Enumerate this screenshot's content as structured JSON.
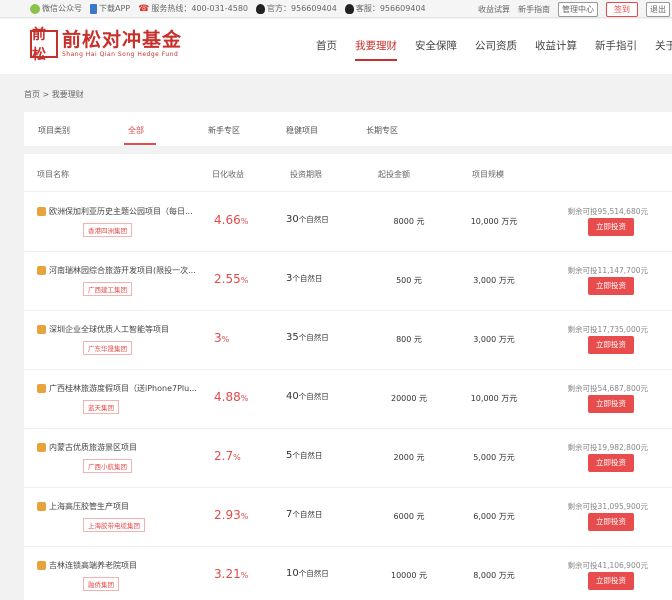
{
  "topbar": {
    "wechat": "微信公众号",
    "app": "下载APP",
    "hotline": "服务热线：400-031-4580",
    "official": "官方：956609404",
    "service": "客服：956609404",
    "links": [
      "收益试算",
      "新手指南"
    ],
    "manage": "管理中心",
    "sign": "签到",
    "logout": "退出"
  },
  "logo": {
    "mark": "前松",
    "cn": "前松对冲基金",
    "en": "Shang Hai Qian Song Hedge Fund"
  },
  "nav": [
    "首页",
    "我要理财",
    "安全保障",
    "公司资质",
    "收益计算",
    "新手指引",
    "关于我们"
  ],
  "breadcrumb": "首页 > 我要理财",
  "categories": {
    "label": "项目类别",
    "items": [
      "全部",
      "新手专区",
      "稳健项目",
      "长期专区"
    ]
  },
  "table": {
    "headers": [
      "项目名称",
      "日化收益",
      "投资期限",
      "起投金额",
      "项目规模"
    ],
    "unit_day": "个自然日",
    "remain_prefix": "剩余可投",
    "invest_label": "立即投资",
    "rows": [
      {
        "name": "欧洲保加利亚历史主题公园项目（每日...",
        "tag": "香港四洲集团",
        "rate": "4.66",
        "term": "30",
        "min": "8000 元",
        "scale": "10,000 万元",
        "remain": "95,514,680元"
      },
      {
        "name": "河南瑞林园综合旅游开发项目(限投一次...",
        "tag": "广西建工集团",
        "rate": "2.55",
        "term": "3",
        "min": "500 元",
        "scale": "3,000 万元",
        "remain": "11,147,700元"
      },
      {
        "name": "深圳企业全球优质人工智能等项目",
        "tag": "广东华晟集团",
        "rate": "3",
        "term": "35",
        "min": "800 元",
        "scale": "3,000 万元",
        "remain": "17,735,000元"
      },
      {
        "name": "广西桂林旅游度假项目（送iPhone7Plu...",
        "tag": "蓝天集团",
        "rate": "4.88",
        "term": "40",
        "min": "20000 元",
        "scale": "10,000 万元",
        "remain": "54,687,800元"
      },
      {
        "name": "内蒙古优质旅游景区项目",
        "tag": "广西小航集团",
        "rate": "2.7",
        "term": "5",
        "min": "2000 元",
        "scale": "5,000 万元",
        "remain": "19,982,800元"
      },
      {
        "name": "上海高压胶管生产项目",
        "tag": "上海胶带电缆集团",
        "rate": "2.93",
        "term": "7",
        "min": "6000 元",
        "scale": "6,000 万元",
        "remain": "31,095,900元"
      },
      {
        "name": "吉林连锁高端养老院项目",
        "tag": "融侨集团",
        "rate": "3.21",
        "term": "10",
        "min": "10000 元",
        "scale": "8,000 万元",
        "remain": "41,106,900元"
      }
    ]
  },
  "colors": {
    "accent": "#e14b4b",
    "brand": "#c8302b"
  }
}
